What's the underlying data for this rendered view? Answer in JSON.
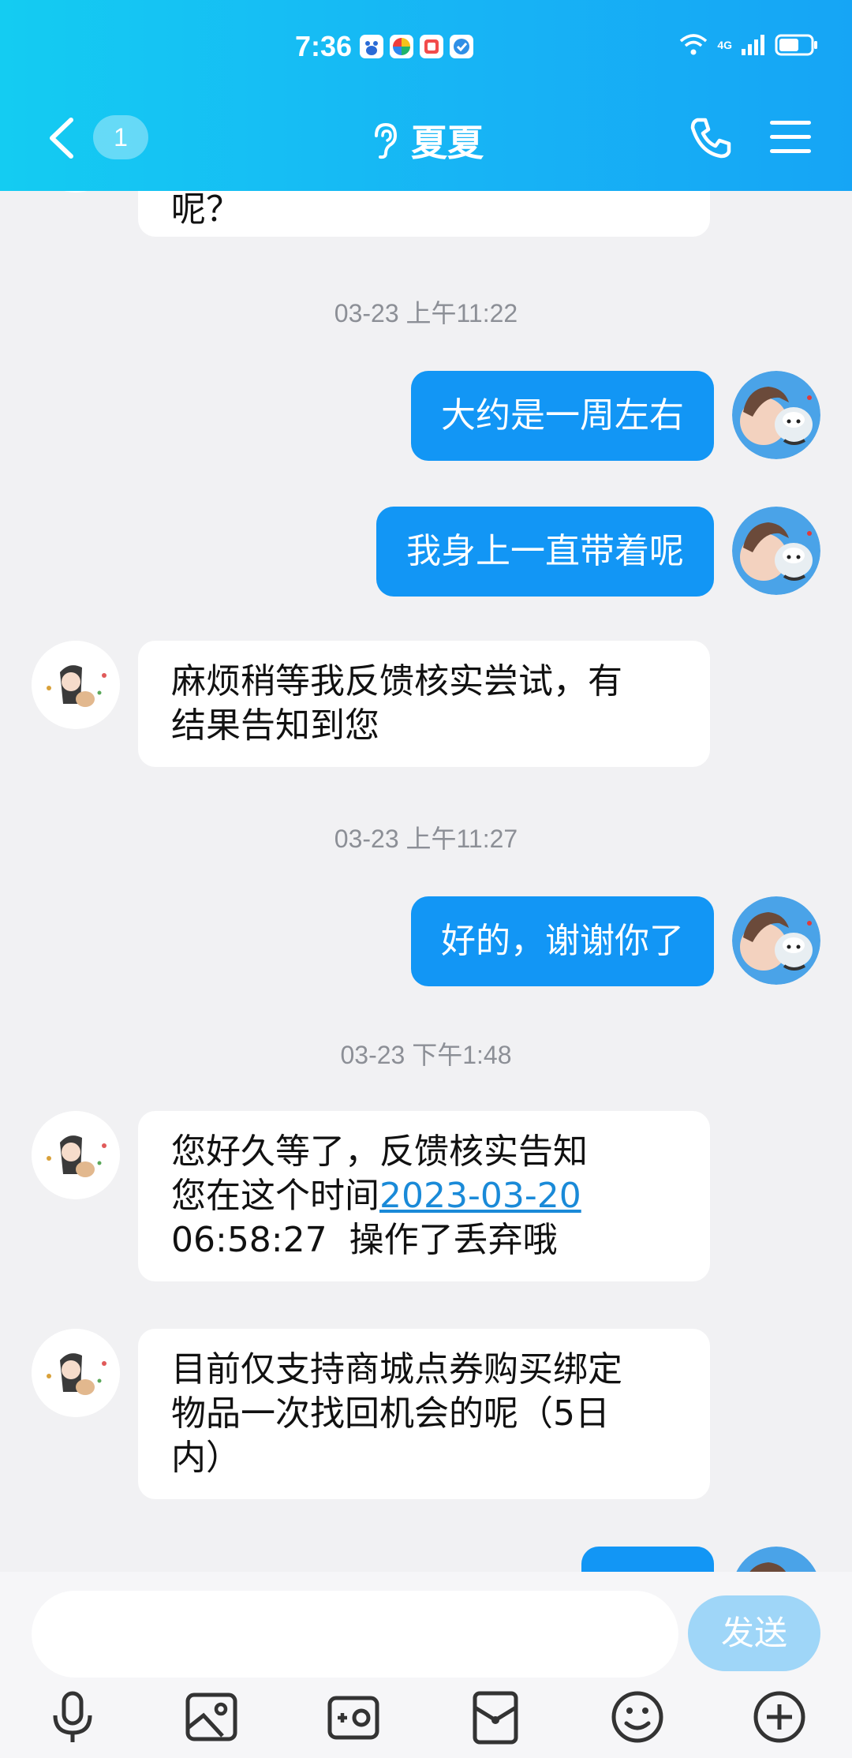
{
  "status_bar": {
    "time": "7:36",
    "network": "4G",
    "app_icon_colors": [
      "#ffffff",
      "#ffffff",
      "#ffffff",
      "#ffffff"
    ]
  },
  "header": {
    "unread_count": "1",
    "contact_name": "夏夏",
    "icons": [
      "back-icon",
      "ear-icon",
      "phone-icon",
      "menu-icon"
    ]
  },
  "messages": {
    "m0": {
      "lines": [
        "呢？"
      ]
    },
    "ts1": "03-23 上午11:22",
    "m1": "大约是一周左右",
    "m2": "我身上一直带着呢",
    "m3": {
      "lines": [
        "麻烦稍等我反馈核实尝试，有",
        "结果告知到您"
      ]
    },
    "ts2": "03-23 上午11:27",
    "m4": "好的，谢谢你了",
    "ts3": "03-23 下午1:48",
    "m5": {
      "line1": "您好久等了，反馈核实告知",
      "line2_prefix": "您在这个时间",
      "line2_link": "2023-03-20",
      "line3": "06:58:27  操作了丢弃哦"
    },
    "m6": {
      "lines": [
        "目前仅支持商城点券购买绑定",
        "物品一次找回机会的呢（5日",
        "内）"
      ]
    }
  },
  "input": {
    "value": "",
    "send_label": "发送"
  },
  "toolbar_icons": [
    "microphone-icon",
    "image-icon",
    "camera-icon",
    "red-packet-icon",
    "emoji-icon",
    "plus-icon"
  ],
  "colors": {
    "header_start": "#14ccf2",
    "header_end": "#16a5f5",
    "outgoing_bubble": "#1296f5",
    "send_button": "#9fd6f8",
    "background": "#f1f1f3"
  }
}
